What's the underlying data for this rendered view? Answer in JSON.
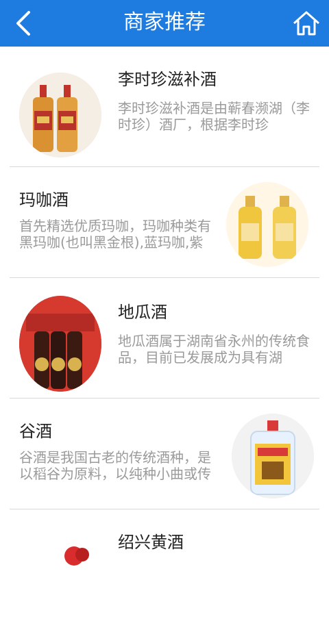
{
  "header": {
    "title": "商家推荐"
  },
  "items": [
    {
      "title": "李时珍滋补酒",
      "desc": "李时珍滋补酒是由蕲春濒湖（李时珍）酒厂，根据李时珍"
    },
    {
      "title": "玛咖酒",
      "desc": "首先精选优质玛咖，玛咖种类有黑玛咖(也叫黑金根),蓝玛咖,紫玛"
    },
    {
      "title": "地瓜酒",
      "desc": "地瓜酒属于湖南省永州的传统食品，目前已发展成为具有湖"
    },
    {
      "title": "谷酒",
      "desc": "谷酒是我国古老的传统酒种，是以稻谷为原料，以纯种小曲或传"
    },
    {
      "title": "绍兴黄酒",
      "desc": ""
    }
  ],
  "colors": {
    "header_bg": "#1e7be0",
    "title": "#222222",
    "desc": "#9a9a9a",
    "divider": "#d8d8d8"
  },
  "icons": {
    "back": "chevron-left-icon",
    "home": "home-icon"
  }
}
